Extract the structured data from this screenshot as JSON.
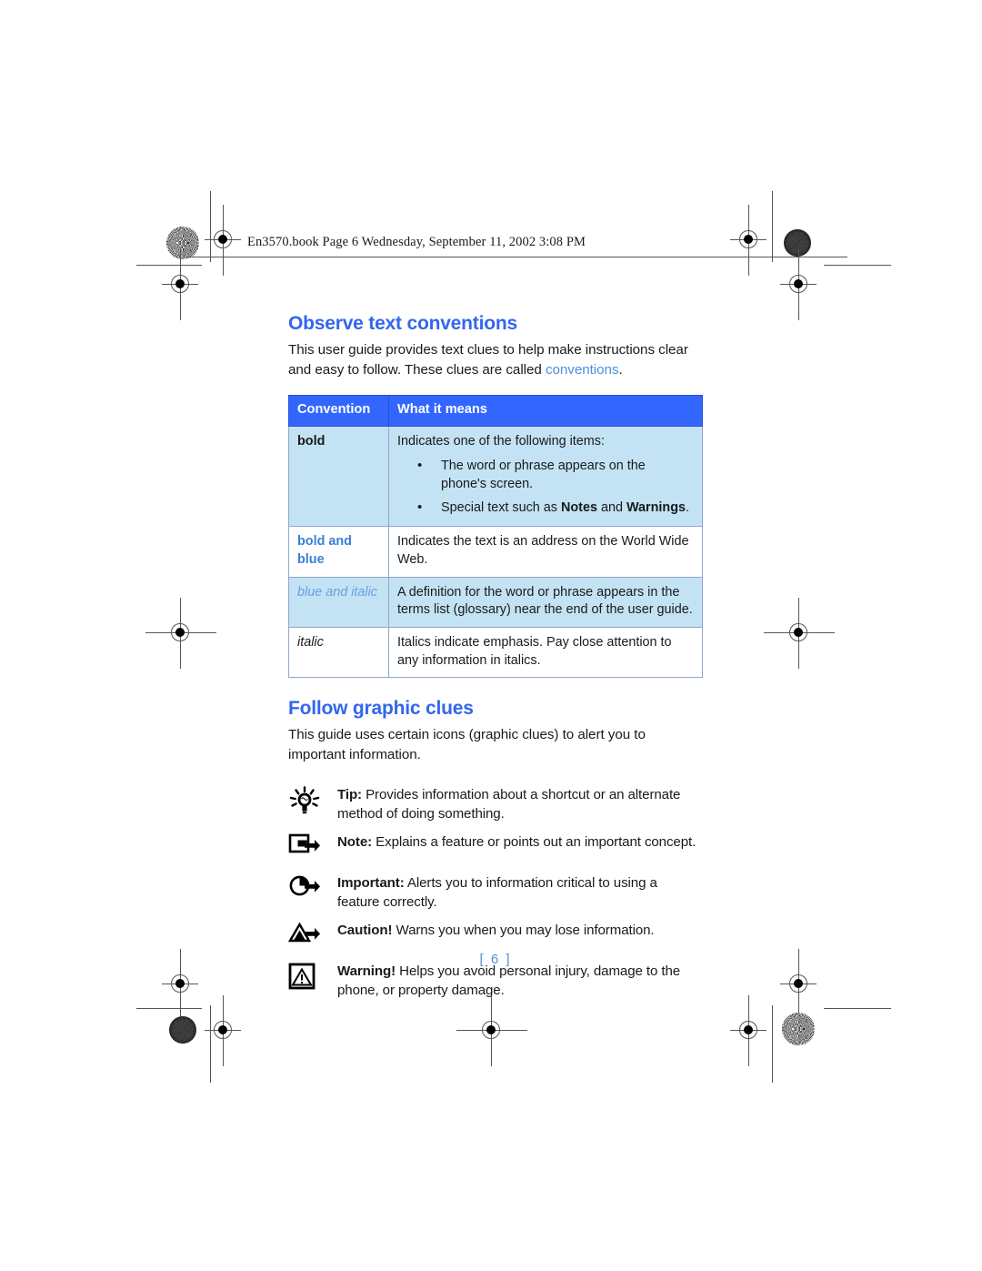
{
  "header": {
    "file_line": "En3570.book  Page 6  Wednesday, September 11, 2002  3:08 PM"
  },
  "sections": {
    "text_conventions": {
      "title": "Observe text conventions",
      "intro_part1": "This user guide provides text clues to help make instructions clear and easy to follow. These clues are called ",
      "intro_highlight": "conventions",
      "intro_part2": "."
    },
    "graphic_clues": {
      "title": "Follow graphic clues",
      "intro": "This guide uses certain icons (graphic clues) to alert you to important information."
    }
  },
  "table": {
    "columns": [
      "Convention",
      "What it means"
    ],
    "rows": [
      {
        "term": "bold",
        "term_style": "bold",
        "desc_intro": "Indicates one of the following items:",
        "bullets": [
          {
            "pre": "The word or phrase appears on the phone's screen.",
            "bold": "",
            "post": ""
          },
          {
            "pre": "Special text such as ",
            "bold": "Notes",
            "mid": " and ",
            "bold2": "Warnings",
            "post": "."
          }
        ],
        "shaded": true
      },
      {
        "term": "bold and blue",
        "term_style": "bold-blue",
        "desc": "Indicates the text is an address on the World Wide Web.",
        "shaded": false
      },
      {
        "term": "blue and italic",
        "term_style": "blue-italic",
        "desc": "A definition for the word or phrase appears in the terms list (glossary) near the end of the user guide.",
        "shaded": true
      },
      {
        "term": "italic",
        "term_style": "italic",
        "desc": "Italics indicate emphasis. Pay close attention to any information in italics.",
        "shaded": false
      }
    ]
  },
  "clues": [
    {
      "icon": "lightbulb-icon",
      "lead": "Tip:",
      "text": " Provides information about a shortcut or an alternate method of doing something."
    },
    {
      "icon": "note-arrow-icon",
      "lead": "Note:",
      "text": " Explains a feature or points out an important concept."
    },
    {
      "icon": "important-circle-arrow-icon",
      "lead": "Important:",
      "text": " Alerts you to information critical to using a feature correctly."
    },
    {
      "icon": "caution-triangle-arrow-icon",
      "lead": "Caution!",
      "text": " Warns you when you may lose information."
    },
    {
      "icon": "warning-boxed-triangle-icon",
      "lead": "Warning!",
      "text": " Helps you avoid personal injury, damage to the phone, or property damage."
    }
  ],
  "footer": {
    "page_number": "[ 6 ]"
  },
  "colors": {
    "heading_blue": "#3366ee",
    "table_header_blue": "#3366ff",
    "row_shade_blue": "#c3e3f5",
    "link_blue": "#4f8fe0"
  }
}
